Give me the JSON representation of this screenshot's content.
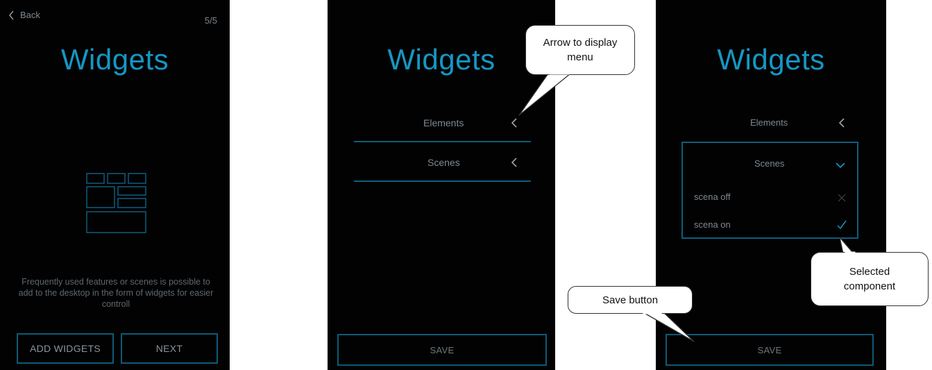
{
  "screen1": {
    "back_label": "Back",
    "page_indicator": "5/5",
    "title": "Widgets",
    "description": "Frequently used features or scenes is possible to add to the desktop in the form of widgets for easier controll",
    "add_widgets_label": "ADD WIDGETS",
    "next_label": "NEXT"
  },
  "screen2": {
    "title": "Widgets",
    "rows": [
      {
        "label": "Elements",
        "icon": "chevron-left-icon"
      },
      {
        "label": "Scenes",
        "icon": "chevron-left-icon"
      }
    ],
    "save_label": "SAVE"
  },
  "screen3": {
    "title": "Widgets",
    "elements_label": "Elements",
    "scenes_label": "Scenes",
    "options": [
      {
        "label": "scena off",
        "icon": "close-icon",
        "selected": false
      },
      {
        "label": "scena on",
        "icon": "checkmark-icon",
        "selected": true
      }
    ],
    "save_label": "SAVE"
  },
  "callouts": {
    "arrow": "Arrow to display menu",
    "selected": "Selected component",
    "save": "Save button"
  },
  "colors": {
    "accent": "#1597c4",
    "border": "#0f5d7c",
    "background": "#020202",
    "text_muted": "#7d8a92"
  }
}
